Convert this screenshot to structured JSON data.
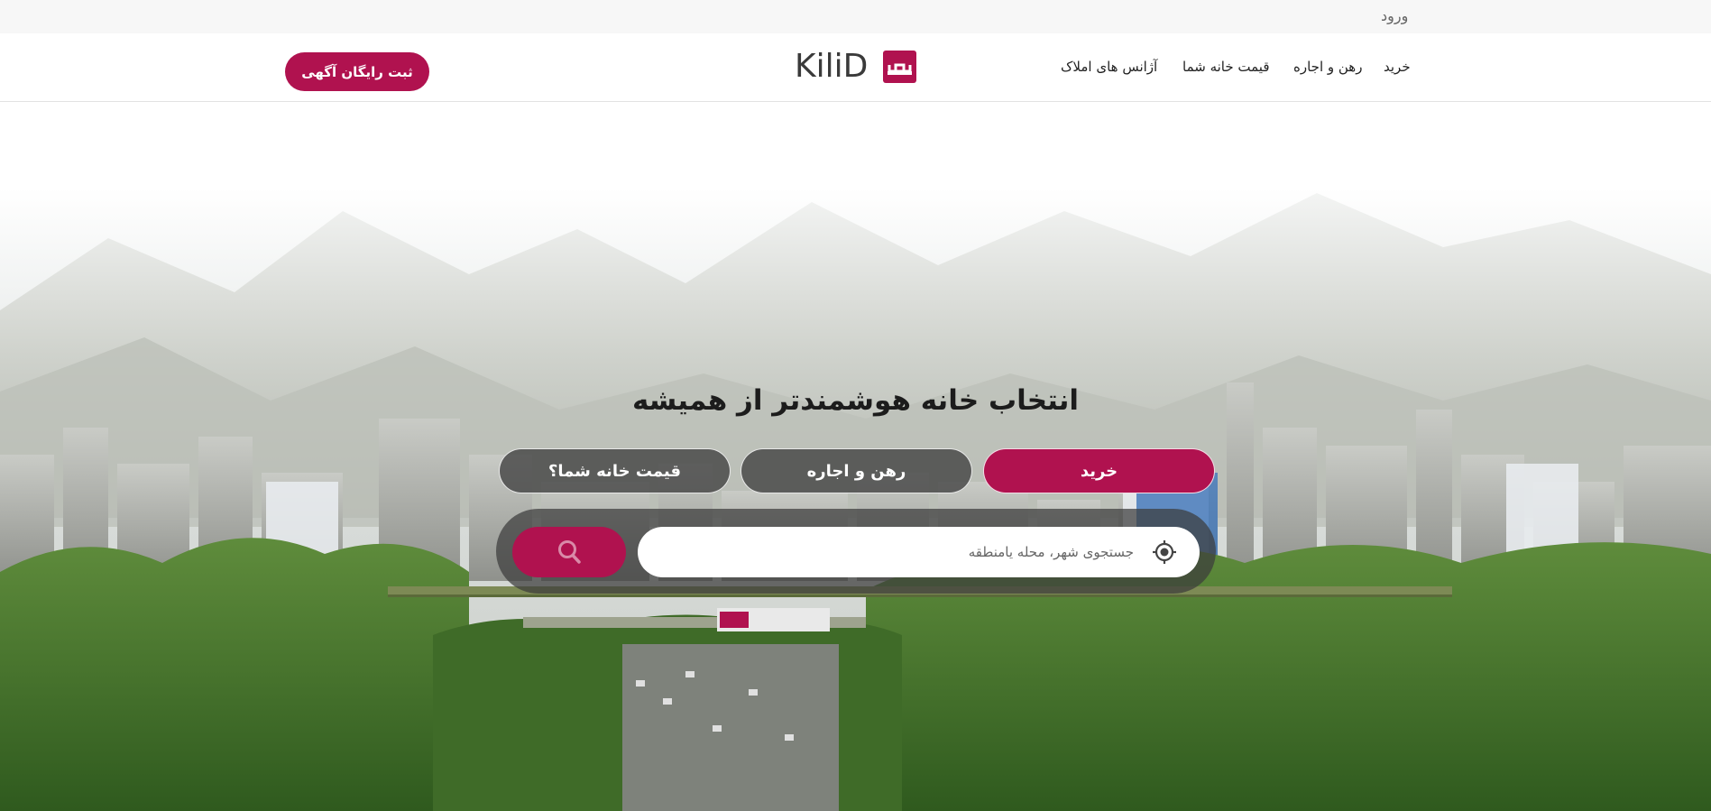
{
  "topbar": {
    "login_label": "ورود"
  },
  "header": {
    "nav": {
      "buy": "خرید",
      "rent": "رهن و اجاره",
      "price": "قیمت خانه شما",
      "agencies": "آژانس های املاک"
    },
    "logo_text": "KiliD",
    "cta_label": "ثبت رایگان آگهی"
  },
  "hero": {
    "headline": "انتخاب خانه هوشمندتر از همیشه",
    "tabs": {
      "buy": "خرید",
      "rent": "رهن و اجاره",
      "price": "قیمت خانه شما؟"
    },
    "search": {
      "placeholder": "جستجوی شهر، محله یامنطقه",
      "value": ""
    }
  },
  "colors": {
    "brand": "#b0124f",
    "text": "#1c1c1c",
    "topbar_bg": "#f7f7f7"
  },
  "icons": {
    "search": "search-icon",
    "locate": "crosshair-locate-icon"
  }
}
